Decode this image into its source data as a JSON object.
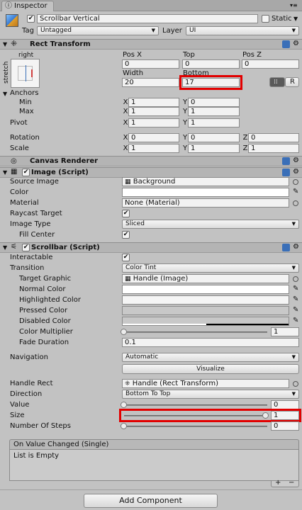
{
  "tab": {
    "label": "Inspector"
  },
  "object": {
    "name": "Scrollbar Vertical",
    "static_label": "Static",
    "tag_label": "Tag",
    "tag_value": "Untagged",
    "layer_label": "Layer",
    "layer_value": "UI"
  },
  "rect_transform": {
    "title": "Rect Transform",
    "anchor_preset_h": "right",
    "anchor_preset_v": "stretch",
    "col1": "Pos X",
    "col2": "Top",
    "col3": "Pos Z",
    "val1": "0",
    "val2": "0",
    "val3": "0",
    "col4": "Width",
    "col5": "Bottom",
    "val4": "20",
    "val5": "17",
    "r_button": "R",
    "anchors_label": "Anchors",
    "min_label": "Min",
    "max_label": "Max",
    "min_x": "1",
    "min_y": "0",
    "max_x": "1",
    "max_y": "1",
    "pivot_label": "Pivot",
    "pivot_x": "1",
    "pivot_y": "1",
    "rotation_label": "Rotation",
    "rot_x": "0",
    "rot_y": "0",
    "rot_z": "0",
    "scale_label": "Scale",
    "scale_x": "1",
    "scale_y": "1",
    "scale_z": "1",
    "x": "X",
    "y": "Y",
    "z": "Z"
  },
  "canvas_renderer": {
    "title": "Canvas Renderer"
  },
  "image_script": {
    "title": "Image (Script)",
    "source_image_label": "Source Image",
    "source_image_value": "Background",
    "color_label": "Color",
    "material_label": "Material",
    "material_value": "None (Material)",
    "raycast_label": "Raycast Target",
    "image_type_label": "Image Type",
    "image_type_value": "Sliced",
    "fill_center_label": "Fill Center"
  },
  "scrollbar_script": {
    "title": "Scrollbar (Script)",
    "interactable_label": "Interactable",
    "transition_label": "Transition",
    "transition_value": "Color Tint",
    "target_graphic_label": "Target Graphic",
    "target_graphic_value": "Handle (Image)",
    "normal_color_label": "Normal Color",
    "highlighted_color_label": "Highlighted Color",
    "pressed_color_label": "Pressed Color",
    "disabled_color_label": "Disabled Color",
    "color_multiplier_label": "Color Multiplier",
    "color_multiplier_value": "1",
    "fade_duration_label": "Fade Duration",
    "fade_duration_value": "0.1",
    "navigation_label": "Navigation",
    "navigation_value": "Automatic",
    "visualize_label": "Visualize",
    "handle_rect_label": "Handle Rect",
    "handle_rect_value": "Handle (Rect Transform)",
    "direction_label": "Direction",
    "direction_value": "Bottom To Top",
    "value_label": "Value",
    "value_value": "0",
    "size_label": "Size",
    "size_value": "1",
    "steps_label": "Number Of Steps",
    "steps_value": "0"
  },
  "event": {
    "title": "On Value Changed (Single)",
    "empty": "List is Empty",
    "plus": "+",
    "minus": "−"
  },
  "add_component": "Add Component",
  "colors": {
    "highlight": "#e20000",
    "header_bg": "#b4b4b4",
    "panel_bg": "#c2c2c2"
  }
}
